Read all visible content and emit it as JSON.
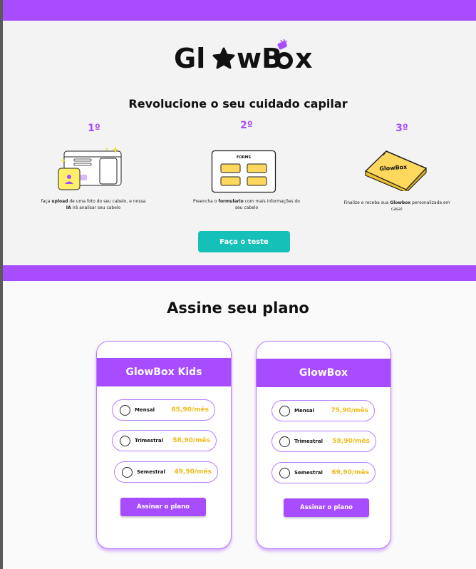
{
  "brand": {
    "logo_part1": "Gl",
    "logo_part2": "wB",
    "logo_part3": "x",
    "accent_color": "#a84cff",
    "teal_color": "#15c0b8",
    "price_color": "#f0bb1a"
  },
  "hero": {
    "headline": "Revolucione o seu cuidado capilar",
    "steps": [
      {
        "number": "1º",
        "desc_pre": "faça ",
        "desc_bold1": "upload",
        "desc_mid": " de uma foto do seu cabelo, e nossa ",
        "desc_bold2": "IA",
        "desc_post": " irá analisar seu cabelo"
      },
      {
        "number": "2º",
        "desc_pre": "Preencha o ",
        "desc_bold1": "formulario",
        "desc_mid": " com mais informações do seu cabelo",
        "image_label": "FORMS"
      },
      {
        "number": "3º",
        "desc_pre": "Finalize e receba sua ",
        "desc_bold1": "Glowbox",
        "desc_mid": " personalizada em casa!",
        "box_label": "GlowBox"
      }
    ],
    "cta_label": "Faça o teste"
  },
  "plans": {
    "title": "Assine seu plano",
    "cards": [
      {
        "name": "GlowBox Kids",
        "options": [
          {
            "label": "Mensal",
            "price": "65,90/mês"
          },
          {
            "label": "Trimestral",
            "price": "58,90/mês"
          },
          {
            "label": "Semestral",
            "price": "49,90/mês"
          }
        ],
        "button": "Assinar o plano"
      },
      {
        "name": "GlowBox",
        "options": [
          {
            "label": "Mensal",
            "price": "75,90/mês"
          },
          {
            "label": "Trimestral",
            "price": "58,90/mês"
          },
          {
            "label": "Semestral",
            "price": "69,90/mês"
          }
        ],
        "button": "Assinar o plano"
      }
    ]
  }
}
